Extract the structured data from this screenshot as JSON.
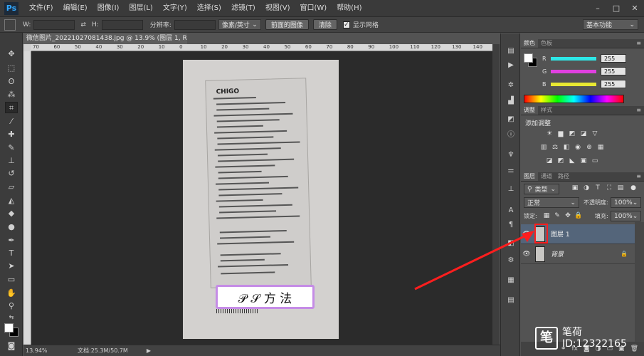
{
  "app": {
    "logo_text": "Ps"
  },
  "menu": {
    "items": [
      "文件(F)",
      "编辑(E)",
      "图像(I)",
      "图层(L)",
      "文字(Y)",
      "选择(S)",
      "滤镜(T)",
      "视图(V)",
      "窗口(W)",
      "帮助(H)"
    ],
    "window_controls": [
      "–",
      "□",
      "✕"
    ]
  },
  "options_bar": {
    "w_label": "W:",
    "h_label": "H:",
    "resolution_label": "分辨率:",
    "unit_select": "像素/英寸",
    "front_image_button": "前面的图像",
    "clear_button": "清除",
    "show_grid_label": "显示网格",
    "show_grid_checked": true,
    "workspace": "基本功能"
  },
  "document": {
    "tab_title": "微信图片_20221027081438.jpg @ 13.9% (图层 1, RGB/8) *",
    "close": "×",
    "ruler_ticks": [
      "70",
      "60",
      "50",
      "40",
      "30",
      "20",
      "10",
      "0",
      "10",
      "20",
      "30",
      "40",
      "50",
      "60",
      "70",
      "80",
      "90",
      "100",
      "110",
      "120",
      "130",
      "140"
    ],
    "zoom": "13.94%",
    "doc_info": "文档:25.3M/50.7M",
    "photo": {
      "brand": "CHIGO",
      "watermark": "𝒫 𝒮 方 法"
    }
  },
  "color_panel": {
    "tabs": [
      "颜色",
      "色板"
    ],
    "channels": [
      {
        "label": "R",
        "value": "255"
      },
      {
        "label": "G",
        "value": "255"
      },
      {
        "label": "B",
        "value": "255"
      }
    ],
    "colors": {
      "r_bar": "#2ee8e8",
      "g_bar": "#e040e0",
      "b_bar": "#e8e832"
    }
  },
  "adjust_panel": {
    "tabs": [
      "调整",
      "样式"
    ],
    "title": "添加调整"
  },
  "layers_panel": {
    "tabs": [
      "图层",
      "通道",
      "路径"
    ],
    "filter": "类型",
    "blend_mode": "正常",
    "opacity_label": "不透明度:",
    "opacity": "100%",
    "lock_label": "锁定:",
    "fill_label": "填充:",
    "fill": "100%",
    "layers": [
      {
        "name": "图层 1",
        "selected": true
      },
      {
        "name": "背景",
        "locked": true
      }
    ]
  },
  "overlay": {
    "brand_logo": "笔",
    "brand_name": "笔荷",
    "brand_id": "ID:12322165",
    "annotation_color": "#ff1e1e"
  }
}
